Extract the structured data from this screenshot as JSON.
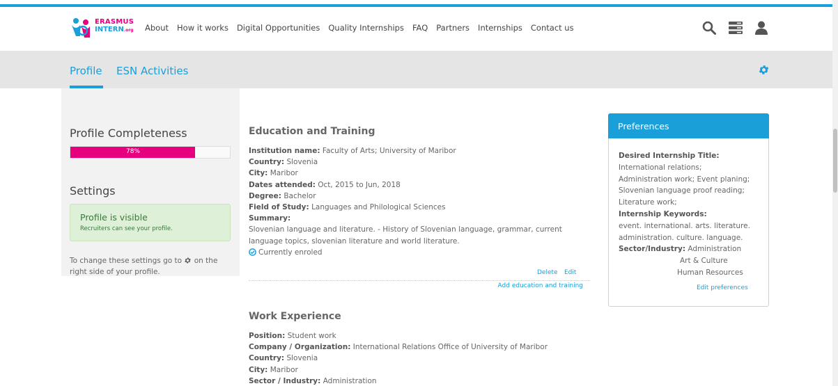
{
  "brand": {
    "line1": "ERASMUS",
    "line2": "INTERN",
    "suffix": ".org"
  },
  "nav": [
    "About",
    "How it works",
    "Digital Opportunities",
    "Quality Internships",
    "FAQ",
    "Partners",
    "Internships",
    "Contact us"
  ],
  "header_icons": [
    "search-icon",
    "menu-icon",
    "user-icon"
  ],
  "tabs": {
    "profile": "Profile",
    "esn": "ESN Activities"
  },
  "sidebar": {
    "completeness_title": "Profile Completeness",
    "completeness_value": "78%",
    "completeness_fraction": 0.78,
    "settings_title": "Settings",
    "visible_title": "Profile is visible",
    "visible_sub": "Recruiters can see your profile.",
    "note_pre": "To change these settings go to",
    "note_post": "on the right side of your profile."
  },
  "education": {
    "title": "Education and Training",
    "rows": [
      {
        "label": "Institution name:",
        "value": "Faculty of Arts; University of Maribor"
      },
      {
        "label": "Country:",
        "value": "Slovenia"
      },
      {
        "label": "City:",
        "value": "Maribor"
      },
      {
        "label": "Dates attended:",
        "value": "Oct, 2015 to Jun, 2018"
      },
      {
        "label": "Degree:",
        "value": "Bachelor"
      },
      {
        "label": "Field of Study:",
        "value": "Languages and Philological Sciences"
      }
    ],
    "summary_label": "Summary:",
    "summary": "Slovenian language and literature. - History of Slovenian language, grammar, current language topics, slovenian literature and world literature.",
    "status": "Currently enroled",
    "delete": "Delete",
    "edit": "Edit",
    "add": "Add education and training"
  },
  "work": {
    "title": "Work Experience",
    "rows": [
      {
        "label": "Position:",
        "value": "Student work"
      },
      {
        "label": "Company / Organization:",
        "value": "International Relations Office of University of Maribor"
      },
      {
        "label": "Country:",
        "value": "Slovenia"
      },
      {
        "label": "City:",
        "value": "Maribor"
      },
      {
        "label": "Sector / Industry:",
        "value": "Administration"
      }
    ]
  },
  "preferences": {
    "title": "Preferences",
    "title_label": "Desired Internship Title:",
    "titles": [
      "International relations;",
      "Administration work; Event planing;",
      "Slovenian language proof reading;",
      "Literature work;"
    ],
    "keywords_label": "Internship Keywords:",
    "keywords": [
      "event. international. arts. literature.",
      "administration. culture. language."
    ],
    "sector_label": "Sector/Industry:",
    "sectors": [
      "Administration",
      "Art & Culture",
      "Human Resources"
    ],
    "edit": "Edit preferences"
  },
  "colors": {
    "accent": "#1a9fd8",
    "brand_pink": "#e6007e",
    "success_bg": "#dff0d8",
    "subheader": "#e5e5e5"
  }
}
